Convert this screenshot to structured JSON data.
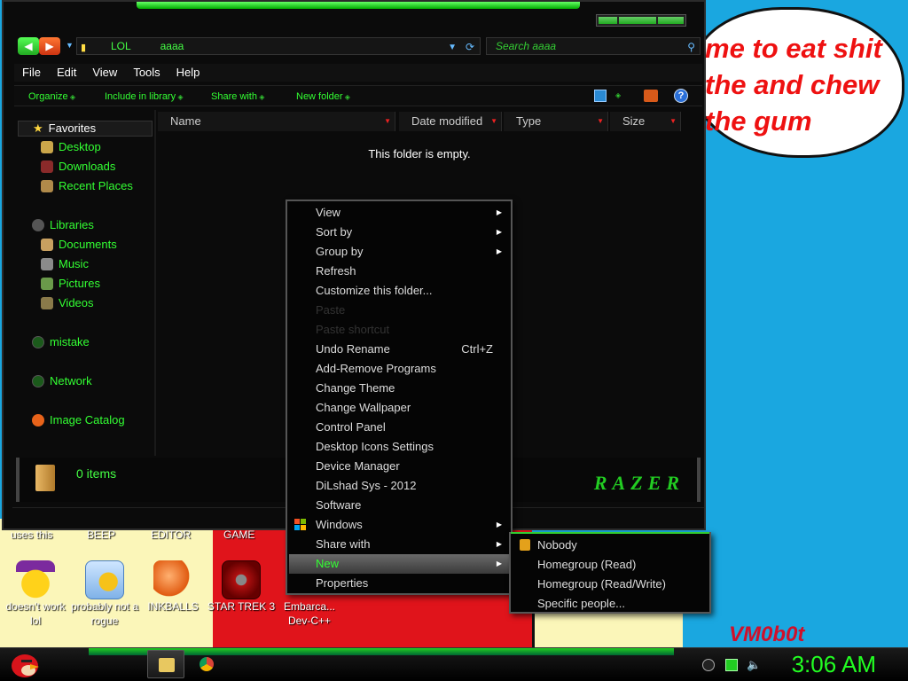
{
  "desktop": {
    "speech_text": "me to eat shit\nthe and chew\nthe gum",
    "signature": "VM0b0t",
    "top_labels": [
      "uses this",
      "BEEP",
      "EDITOR",
      "GAME"
    ],
    "icons": [
      {
        "label": "doesn't work lol",
        "name": "yahoo-messenger-icon"
      },
      {
        "label": "probably not a rogue",
        "name": "gears-program-icon"
      },
      {
        "label": "INKBALLS",
        "name": "inkball-icon"
      },
      {
        "label": "STAR TREK 3",
        "name": "star-trek-game-icon"
      },
      {
        "label": "Embarca... Dev-C++",
        "name": "dev-cpp-icon"
      }
    ]
  },
  "window": {
    "address": {
      "segment1": "LOL",
      "segment2": "aaaa"
    },
    "search_placeholder": "Search aaaa",
    "menu": [
      "File",
      "Edit",
      "View",
      "Tools",
      "Help"
    ],
    "toolbar": {
      "organize": "Organize",
      "include": "Include in library",
      "share": "Share with",
      "new_folder": "New folder"
    },
    "sidebar": {
      "favorites": "Favorites",
      "desktop": "Desktop",
      "downloads": "Downloads",
      "recent": "Recent Places",
      "libraries": "Libraries",
      "documents": "Documents",
      "music": "Music",
      "pictures": "Pictures",
      "videos": "Videos",
      "mistake": "mistake",
      "network": "Network",
      "image_catalog": "Image Catalog"
    },
    "columns": {
      "name": "Name",
      "date": "Date modified",
      "type": "Type",
      "size": "Size"
    },
    "empty_message": "This folder is empty.",
    "status": "0 items",
    "brand": "RAZER"
  },
  "context_menu": {
    "view": "View",
    "sort_by": "Sort by",
    "group_by": "Group by",
    "refresh": "Refresh",
    "customize": "Customize this folder...",
    "paste": "Paste",
    "paste_shortcut": "Paste shortcut",
    "undo": "Undo Rename",
    "undo_key": "Ctrl+Z",
    "add_remove": "Add-Remove Programs",
    "change_theme": "Change Theme",
    "change_wallpaper": "Change Wallpaper",
    "control_panel": "Control Panel",
    "desktop_icons": "Desktop Icons Settings",
    "device_manager": "Device Manager",
    "dilshad": "DiLshad Sys - 2012",
    "software": "Software",
    "windows": "Windows",
    "share_with": "Share with",
    "new": "New",
    "properties": "Properties"
  },
  "submenu": {
    "nobody": "Nobody",
    "homegroup_read": "Homegroup (Read)",
    "homegroup_rw": "Homegroup (Read/Write)",
    "specific": "Specific people..."
  },
  "taskbar": {
    "clock": "3:06 AM"
  },
  "colors": {
    "accent": "#33ff33",
    "desktop_bg": "#1aa7e0",
    "highlight": "#6a6a6a"
  }
}
